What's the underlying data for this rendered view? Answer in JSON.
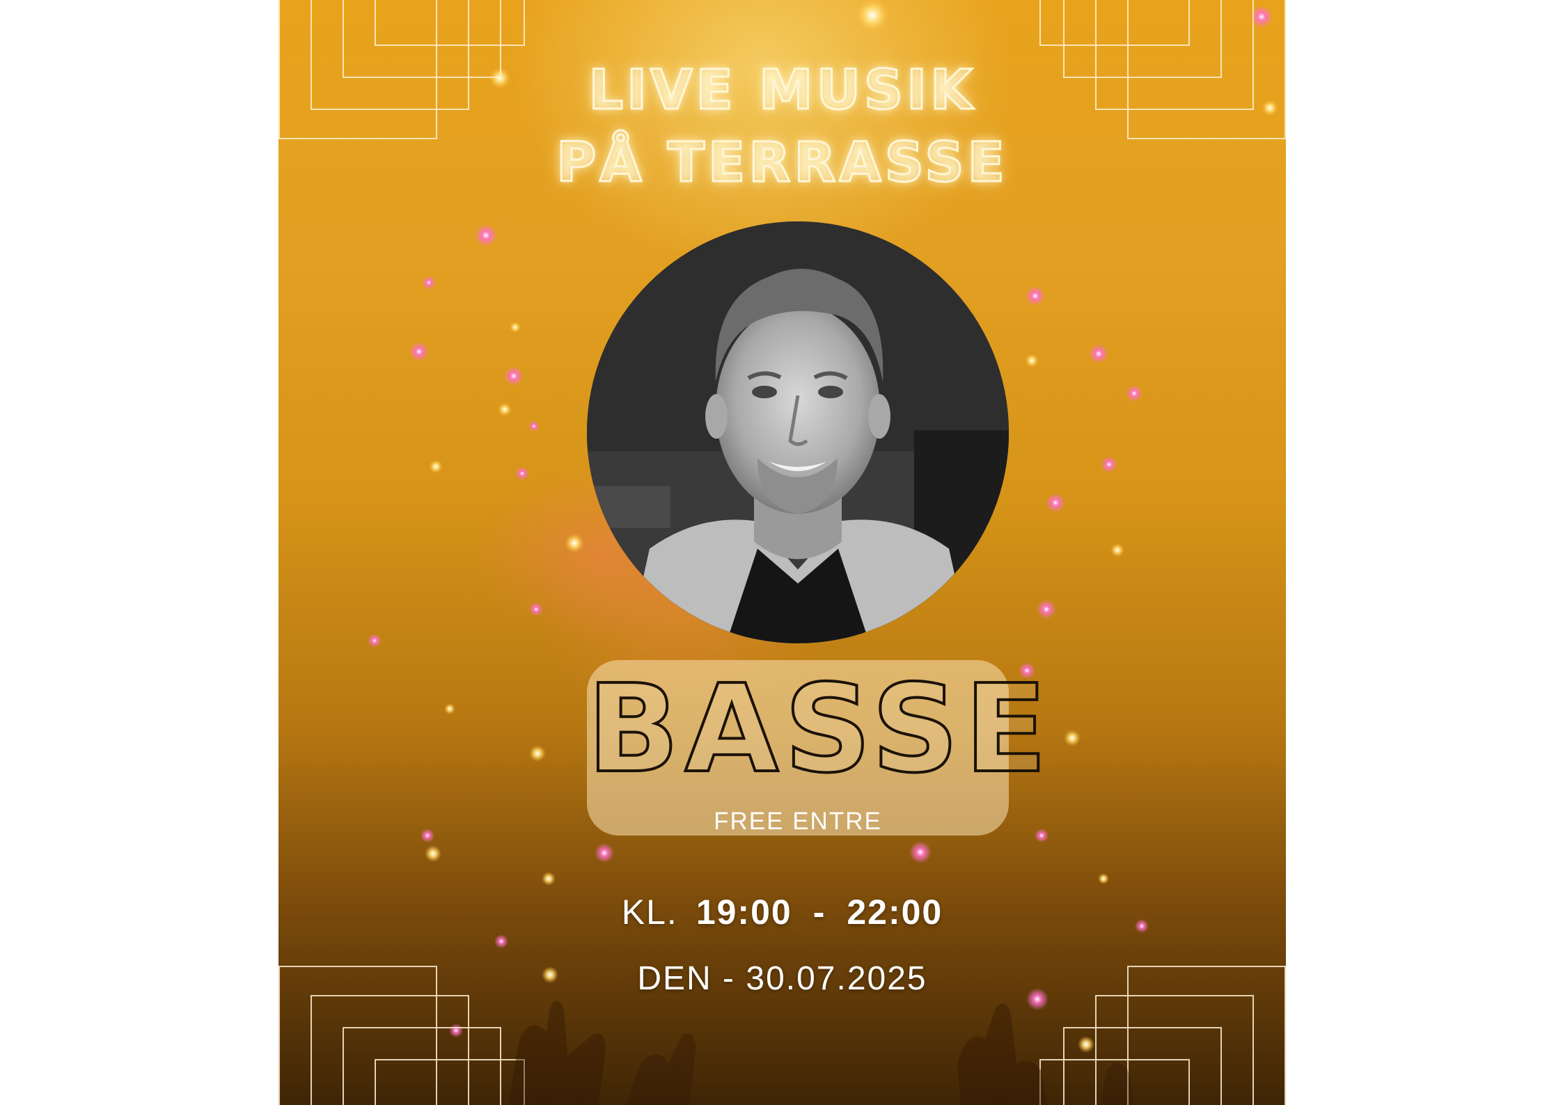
{
  "poster": {
    "title_line1": "LIVE MUSIK",
    "title_line2": "PÅ TERRASSE",
    "artist_name": "BASSE",
    "entry_note": "FREE ENTRE",
    "time_prefix": "KL.",
    "time_start": "19:00",
    "time_separator": "-",
    "time_end": "22:00",
    "date_line": "DEN - 30.07.2025"
  },
  "colors": {
    "background_top": "#e8a21c",
    "background_bottom": "#3f2506",
    "neon_text": "#fff6d8",
    "name_outline": "#1b1208",
    "name_box": "#fae4b4"
  }
}
